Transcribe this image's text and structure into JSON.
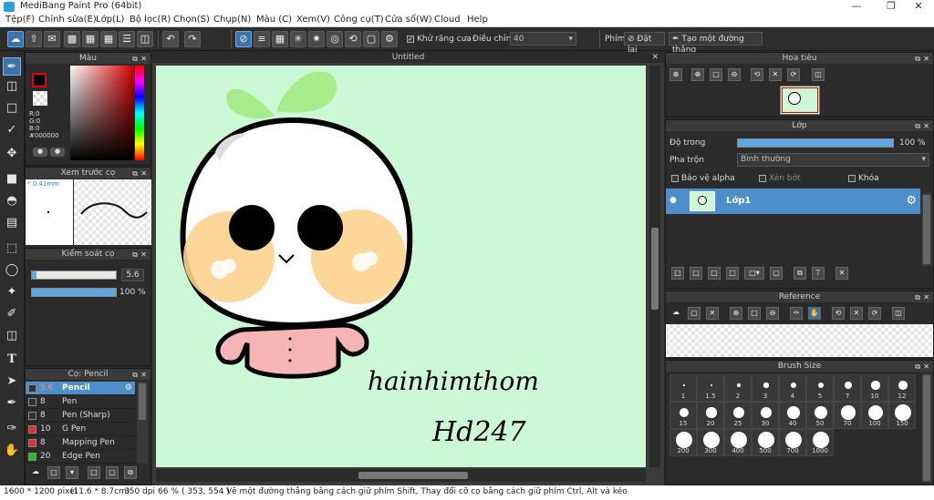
{
  "window": {
    "title": "MediBang Paint Pro (64bit)"
  },
  "menu": [
    "Tệp(F)",
    "Chỉnh sửa(E)",
    "Lớp(L)",
    "Bộ lọc(R)",
    "Chọn(S)",
    "Chụp(N)",
    "Màu (C)",
    "Xem(V)",
    "Công cụ(T)",
    "Cửa sổ(W)",
    "Cloud",
    "Help"
  ],
  "toolbar": {
    "antialias_label": "Khử răng cưa",
    "adjust_label": "Điều chỉnh",
    "adjust_value": "40",
    "phim_label": "Phím",
    "set_label": "Đặt lại",
    "straight_label": "Tạo một đường thẳng"
  },
  "color_panel": {
    "title": "Màu",
    "r": "R:0",
    "g": "G:0",
    "b": "B:0",
    "hex": "#000000",
    "primary": "#000000",
    "secondary": "#ffffff"
  },
  "brush_preview": {
    "title": "Xem trước cọ",
    "size": "0.41mm"
  },
  "brush_control": {
    "title": "Kiểm soát cọ",
    "size": "5.6",
    "size_pct": 0.05,
    "opacity": "100 %",
    "opacity_pct": 1.0
  },
  "brush_list": {
    "title": "Cọ: Pencil",
    "items": [
      {
        "size": "5.6",
        "name": "Pencil",
        "color": "#333333"
      },
      {
        "size": "8",
        "name": "Pen",
        "color": "#333333"
      },
      {
        "size": "8",
        "name": "Pen (Sharp)",
        "color": "#333333"
      },
      {
        "size": "10",
        "name": "G Pen",
        "color": "#e03030"
      },
      {
        "size": "8",
        "name": "Mapping Pen",
        "color": "#e03030"
      },
      {
        "size": "20",
        "name": "Edge Pen",
        "color": "#20c020"
      }
    ]
  },
  "canvas": {
    "tab": "Untitled",
    "text1": "hainhimthom",
    "text2": "Hd247",
    "background": "#ccf8d5"
  },
  "navigator": {
    "title": "Hoa tiêu"
  },
  "layer_panel": {
    "title": "Lớp",
    "opacity_label": "Độ trong",
    "opacity_value": "100 %",
    "blend_label": "Pha trộn",
    "blend_value": "Bình thường",
    "protect_alpha": "Bảo vệ alpha",
    "clip": "Xén bớt",
    "lock": "Khóa",
    "layers": [
      {
        "name": "Lớp1"
      }
    ]
  },
  "reference": {
    "title": "Reference"
  },
  "brush_size": {
    "title": "Brush Size",
    "sizes": [
      "1",
      "1.5",
      "2",
      "3",
      "4",
      "5",
      "7",
      "10",
      "12",
      "15",
      "20",
      "25",
      "30",
      "40",
      "50",
      "70",
      "100",
      "150",
      "200",
      "300",
      "400",
      "500",
      "700",
      "1000"
    ]
  },
  "status": {
    "dims": "1600 * 1200 pixel",
    "cm": "(11.6 * 8.7cm)",
    "dpi": "350 dpi",
    "zoom": "66 %",
    "coords": "( 353, 554 )",
    "hint": "Vẽ một đường thẳng bằng cách giữ phím Shift, Thay đổi cỡ cọ bằng cách giữ phím Ctrl, Alt và kéo"
  }
}
